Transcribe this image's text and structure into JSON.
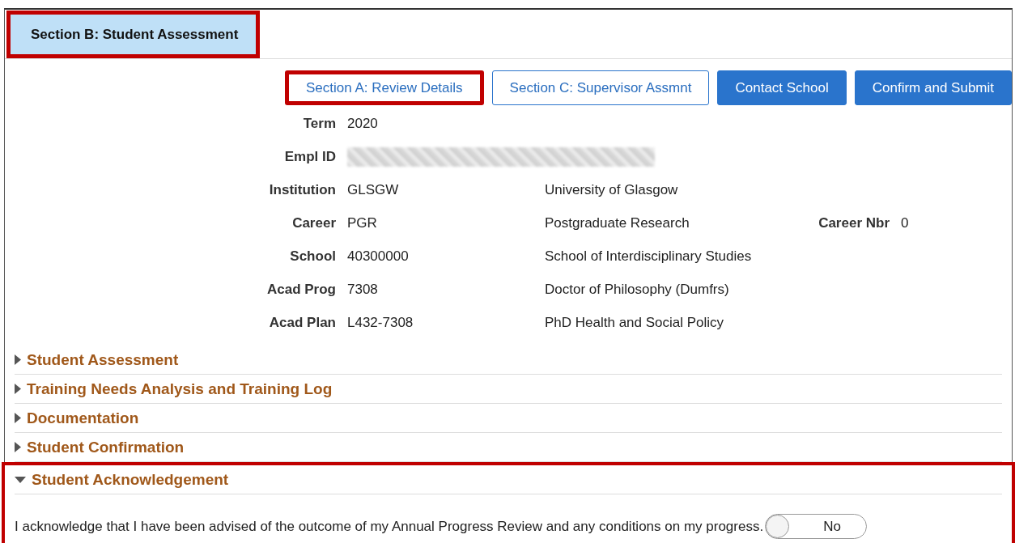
{
  "tab": {
    "label": "Section B: Student Assessment",
    "highlighted": true
  },
  "buttons": [
    {
      "label": "Section A: Review Details",
      "kind": "outline",
      "highlighted": true
    },
    {
      "label": "Section C: Supervisor Assmnt",
      "kind": "outline",
      "highlighted": false
    },
    {
      "label": "Contact School",
      "kind": "primary",
      "highlighted": false
    },
    {
      "label": "Confirm and Submit",
      "kind": "primary",
      "highlighted": false
    }
  ],
  "fields": [
    {
      "label": "Term",
      "kind": "text",
      "value": "2020"
    },
    {
      "label": "Empl ID",
      "kind": "redacted"
    },
    {
      "label": "Institution",
      "kind": "text",
      "value": "GLSGW",
      "description": "University of Glasgow"
    },
    {
      "label": "Career",
      "kind": "text",
      "value": "PGR",
      "description": "Postgraduate Research",
      "extra_label": "Career Nbr",
      "extra_value": "0"
    },
    {
      "label": "School",
      "kind": "text",
      "value": "40300000",
      "description": "School of Interdisciplinary Studies"
    },
    {
      "label": "Acad Prog",
      "kind": "text",
      "value": "7308",
      "description": "Doctor of Philosophy (Dumfrs)"
    },
    {
      "label": "Acad Plan",
      "kind": "text",
      "value": "L432-7308",
      "description": "PhD Health and Social Policy"
    }
  ],
  "sections": [
    {
      "title": "Student Assessment",
      "expanded": false,
      "highlighted": false
    },
    {
      "title": "Training Needs Analysis and Training Log",
      "expanded": false,
      "highlighted": false
    },
    {
      "title": "Documentation",
      "expanded": false,
      "highlighted": false
    },
    {
      "title": "Student Confirmation",
      "expanded": false,
      "highlighted": false
    },
    {
      "title": "Student Acknowledgement",
      "expanded": true,
      "highlighted": true,
      "statement": "I acknowledge that I have been advised of the outcome of my Annual Progress Review and any conditions on my progress.",
      "toggle": {
        "on": false,
        "label": "No"
      }
    }
  ]
}
